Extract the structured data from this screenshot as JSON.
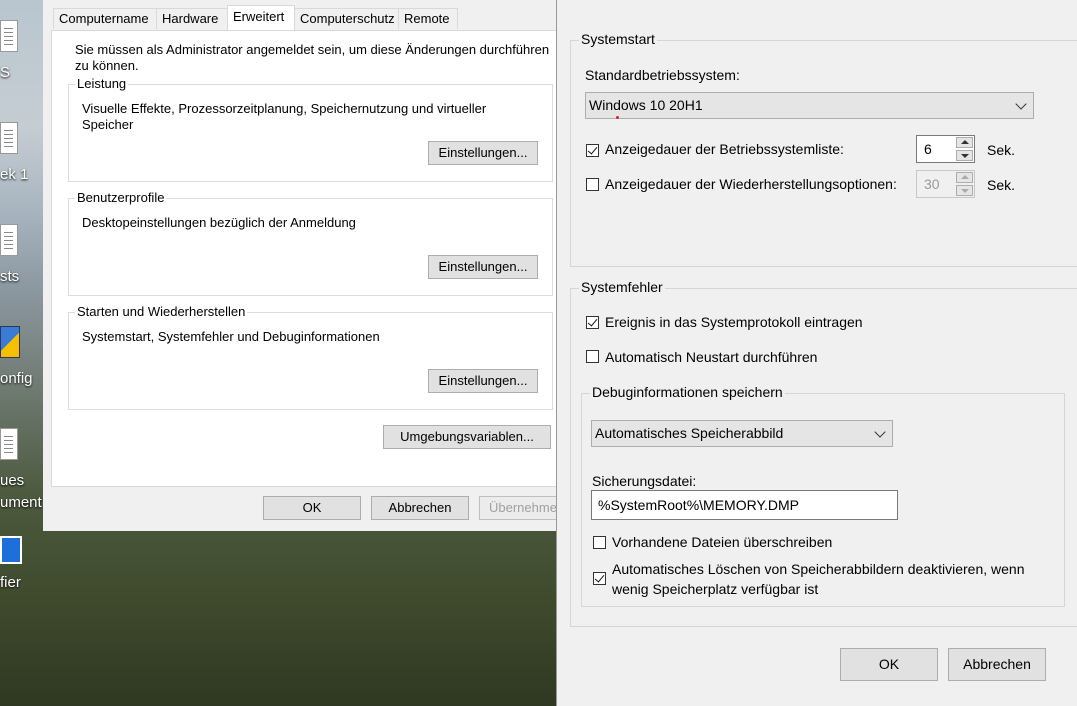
{
  "desktop": {
    "icons": [
      {
        "label": "S",
        "icon": "document-icon"
      },
      {
        "label": "ek 1",
        "icon": "document-icon"
      },
      {
        "label": "sts",
        "icon": "document-icon"
      },
      {
        "label": "onfig",
        "icon": "shield-icon"
      },
      {
        "label": "ues",
        "icon": "document-icon"
      },
      {
        "label": "ument",
        "icon": "document-icon"
      },
      {
        "label": "fier",
        "icon": "app-icon"
      }
    ]
  },
  "system_properties": {
    "tabs": [
      "Computername",
      "Hardware",
      "Erweitert",
      "Computerschutz",
      "Remote"
    ],
    "active_tab": "Erweitert",
    "admin_notice": "Sie müssen als Administrator angemeldet sein, um diese Änderungen durchführen zu können.",
    "admin_notice_line1": "Sie müssen als Administrator angemeldet sein, um diese Änderungen durchführen",
    "admin_notice_line2": "zu können.",
    "performance": {
      "title": "Leistung",
      "description_line1": "Visuelle Effekte, Prozessorzeitplanung, Speichernutzung und virtueller",
      "description_line2": "Speicher",
      "button": "Einstellungen..."
    },
    "user_profiles": {
      "title": "Benutzerprofile",
      "description": "Desktopeinstellungen bezüglich der Anmeldung",
      "button": "Einstellungen..."
    },
    "startup_recovery": {
      "title": "Starten und Wiederherstellen",
      "description": "Systemstart, Systemfehler und Debuginformationen",
      "button": "Einstellungen..."
    },
    "env_button": "Umgebungsvariablen...",
    "ok": "OK",
    "cancel": "Abbrechen",
    "apply": "Übernehmen"
  },
  "startup_dialog": {
    "system_start": {
      "title": "Systemstart",
      "default_os_label": "Standardbetriebssystem:",
      "default_os_value": "Windows 10 20H1",
      "os_list_label": "Anzeigedauer der Betriebssystemliste:",
      "os_list_checked": true,
      "os_list_value": "6",
      "recovery_label": "Anzeigedauer der Wiederherstellungsoptionen:",
      "recovery_checked": false,
      "recovery_value": "30",
      "unit": "Sek."
    },
    "system_failure": {
      "title": "Systemfehler",
      "write_event_label": "Ereignis in das Systemprotokoll eintragen",
      "write_event_checked": true,
      "auto_restart_label": "Automatisch Neustart durchführen",
      "auto_restart_checked": false,
      "debug_group_title": "Debuginformationen speichern",
      "debug_type_value": "Automatisches Speicherabbild",
      "dump_file_label": "Sicherungsdatei:",
      "dump_file_value": "%SystemRoot%\\MEMORY.DMP",
      "overwrite_label": "Vorhandene Dateien überschreiben",
      "overwrite_checked": false,
      "disable_autodelete_line1": "Automatisches Löschen von Speicherabbildern deaktivieren, wenn",
      "disable_autodelete_line2": "wenig Speicherplatz verfügbar ist",
      "disable_autodelete_checked": true
    },
    "ok": "OK",
    "cancel": "Abbrechen"
  }
}
